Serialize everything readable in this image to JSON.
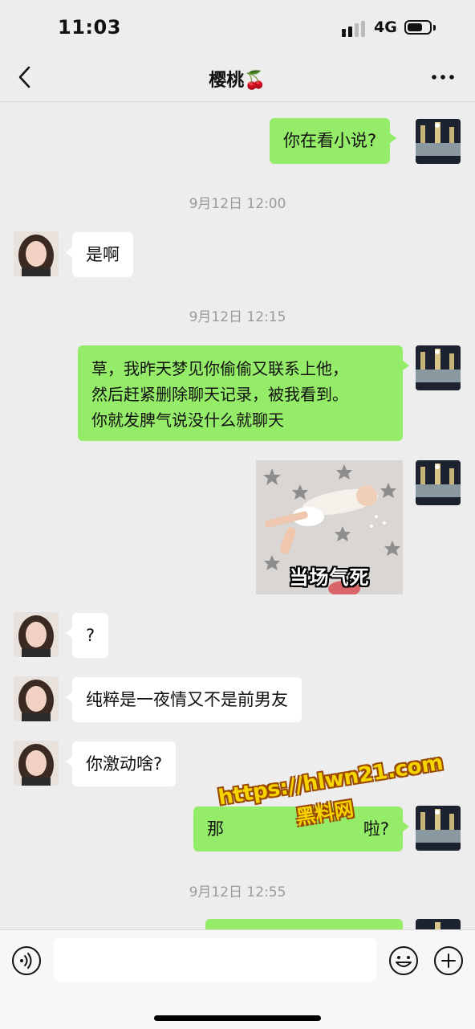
{
  "status_bar": {
    "time": "11:03",
    "network": "4G",
    "battery_level": 0.7
  },
  "nav": {
    "title": "樱桃🍒",
    "back_icon": "chevron-left-icon",
    "more_icon": "ellipsis-icon"
  },
  "messages": [
    {
      "sender": "self",
      "text": "你在看小说?"
    },
    {
      "timestamp": "9月12日 12:00"
    },
    {
      "sender": "other",
      "text": "是啊"
    },
    {
      "timestamp": "9月12日 12:15"
    },
    {
      "sender": "self",
      "lines": [
        "草，我昨天梦见你偷偷又联系上他，",
        "然后赶紧删除聊天记录，被我看到。",
        "你就发脾气说没什么就聊天"
      ]
    },
    {
      "sender": "self",
      "sticker_caption": "当场气死"
    },
    {
      "sender": "other",
      "text": "?"
    },
    {
      "sender": "other",
      "text": "纯粹是一夜情又不是前男友"
    },
    {
      "sender": "other",
      "text": "你激动啥?"
    },
    {
      "sender": "self",
      "text_left": "那",
      "text_right": "啦?"
    },
    {
      "timestamp": "9月12日 12:55"
    }
  ],
  "watermark": {
    "url": "https://hlwn21.com",
    "site": "黑料网"
  },
  "input_bar": {
    "voice_icon": "voice-icon",
    "emoji_icon": "emoji-icon",
    "plus_icon": "plus-circle-icon",
    "placeholder": ""
  },
  "colors": {
    "self_bubble": "#95ec69",
    "other_bubble": "#ffffff",
    "background": "#ededed",
    "timestamp": "#9a9a9a"
  }
}
